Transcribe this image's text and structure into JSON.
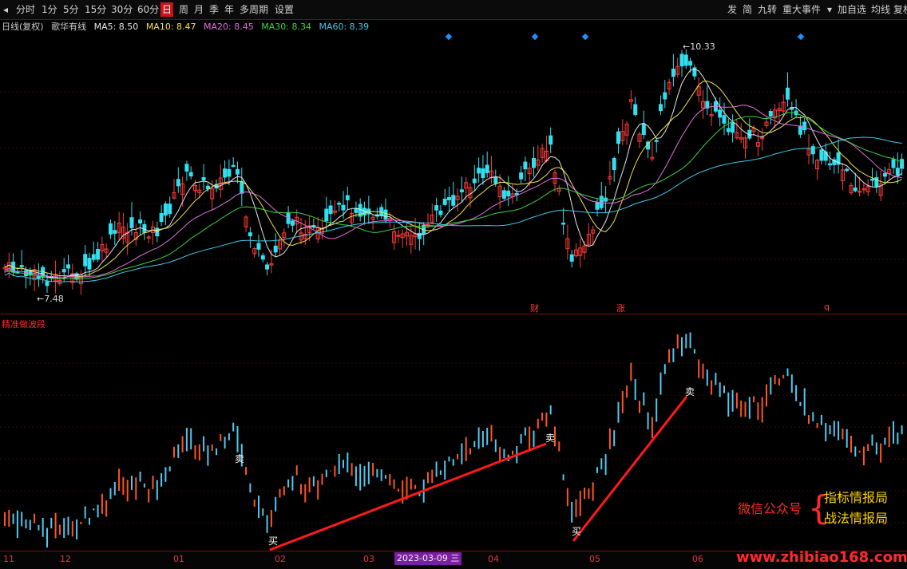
{
  "toolbar": {
    "left_items": [
      "分时",
      "1分",
      "5分",
      "15分",
      "30分",
      "60分",
      "日",
      "周",
      "月",
      "季",
      "年",
      "多周期",
      "设置"
    ],
    "active": "日",
    "right_items": [
      "发",
      "简",
      "九转",
      "重大事件",
      "加自选",
      "均线",
      "复权"
    ]
  },
  "ma_bar": {
    "title": "日线(复权)",
    "indicator": "歌华有线",
    "items": [
      {
        "label": "MA5: 8.50",
        "color": "#e6e6e6"
      },
      {
        "label": "MA10: 8.47",
        "color": "#f0e050"
      },
      {
        "label": "MA20: 8.45",
        "color": "#e070e0"
      },
      {
        "label": "MA30: 8.34",
        "color": "#40d040"
      },
      {
        "label": "MA60: 8.39",
        "color": "#40c8e8"
      }
    ]
  },
  "price_labels": {
    "high": "10.33",
    "low": "7.48"
  },
  "event_tags": [
    "财",
    "涨",
    "q"
  ],
  "sub_panel": {
    "title": "精准做波段",
    "sell": "卖",
    "buy": "买"
  },
  "x_axis": {
    "labels": [
      "11",
      "12",
      "01",
      "02",
      "03",
      "04",
      "05",
      "06"
    ],
    "date_tag": "2023-03-09 三"
  },
  "watermark": {
    "wechat": "微信公众号",
    "line1": "指标情报局",
    "line2": "战法情报局",
    "url": "www.zhibiao168.com"
  },
  "colors": {
    "up": "#ff3a3a",
    "down": "#30e0f0",
    "accent": "#c8141c"
  },
  "chart_data": {
    "type": "candlestick",
    "price_high": 10.33,
    "price_low": 7.48,
    "ylim": [
      7.3,
      10.6
    ]
  }
}
